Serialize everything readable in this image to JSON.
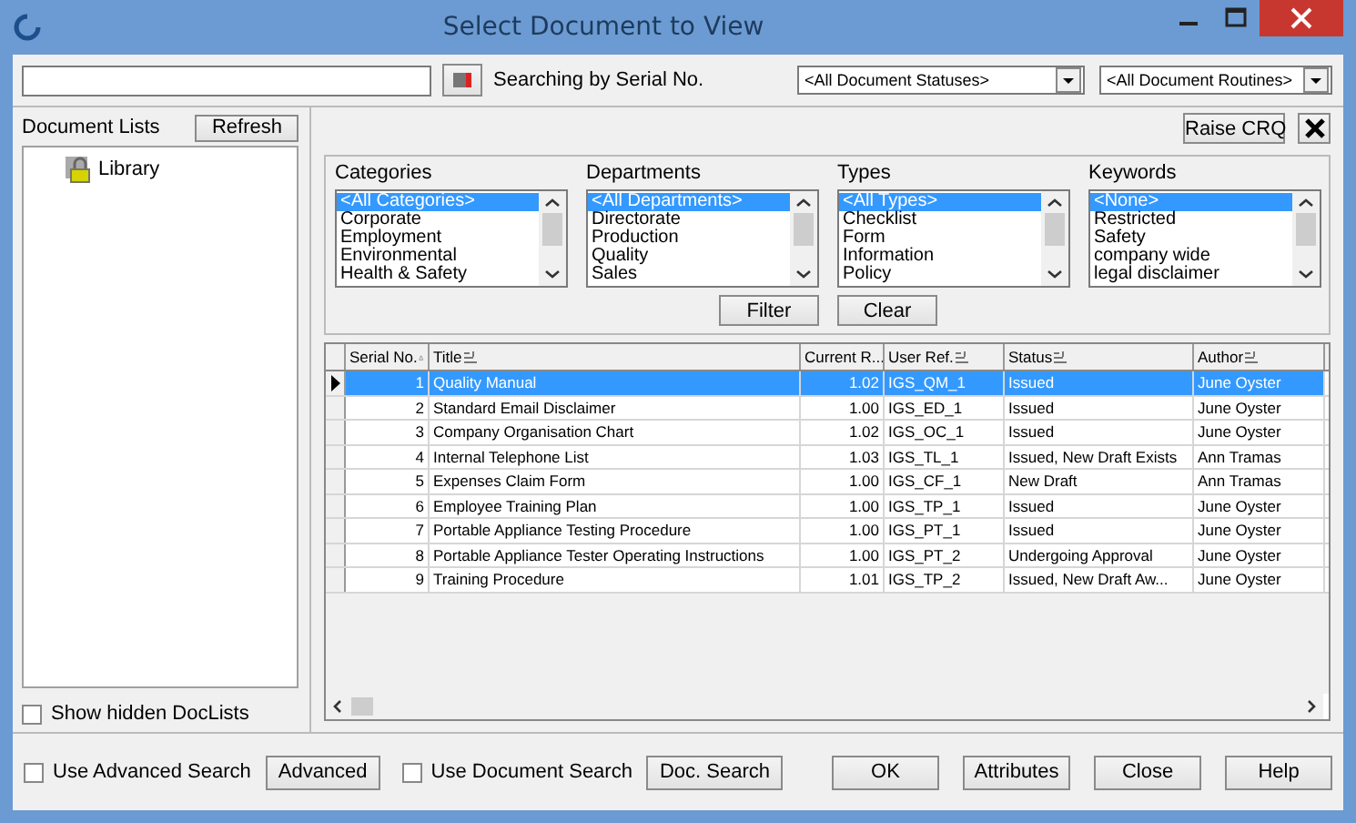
{
  "window": {
    "title": "Select Document to View"
  },
  "search": {
    "label": "Searching by Serial No.",
    "status_filter": "<All Document Statuses>",
    "routine_filter": "<All Document Routines>"
  },
  "document_lists": {
    "heading": "Document Lists",
    "refresh_button": "Refresh",
    "items": [
      {
        "label": "Library",
        "selected": false
      }
    ],
    "show_hidden": {
      "label": "Show hidden DocLists",
      "checked": false
    }
  },
  "raise_button": "Raise CRQ",
  "filters": [
    {
      "title": "Categories",
      "items": [
        {
          "label": "<All Categories>",
          "selected": true
        },
        {
          "label": "Corporate",
          "selected": false
        },
        {
          "label": "Employment",
          "selected": false
        },
        {
          "label": "Environmental",
          "selected": false
        },
        {
          "label": "Health & Safety",
          "selected": false
        }
      ]
    },
    {
      "title": "Departments",
      "items": [
        {
          "label": "<All Departments>",
          "selected": true
        },
        {
          "label": "Directorate",
          "selected": false
        },
        {
          "label": "Production",
          "selected": false
        },
        {
          "label": "Quality",
          "selected": false
        },
        {
          "label": "Sales",
          "selected": false
        }
      ]
    },
    {
      "title": "Types",
      "items": [
        {
          "label": "<All Types>",
          "selected": true
        },
        {
          "label": "Checklist",
          "selected": false
        },
        {
          "label": "Form",
          "selected": false
        },
        {
          "label": "Information",
          "selected": false
        },
        {
          "label": "Policy",
          "selected": false
        }
      ]
    },
    {
      "title": "Keywords",
      "items": [
        {
          "label": "<None>",
          "selected": true
        },
        {
          "label": "Restricted",
          "selected": false
        },
        {
          "label": "Safety",
          "selected": false
        },
        {
          "label": "company wide",
          "selected": false
        },
        {
          "label": "legal disclaimer",
          "selected": false
        }
      ]
    }
  ],
  "filter_buttons": [
    "Filter",
    "Clear"
  ],
  "table": {
    "columns": [
      {
        "label": "Serial No.",
        "kind": "sort"
      },
      {
        "label": "Title",
        "kind": "filter"
      },
      {
        "label": "Current R...",
        "kind": "plain"
      },
      {
        "label": "User Ref.",
        "kind": "filter"
      },
      {
        "label": "Status",
        "kind": "filter"
      },
      {
        "label": "Author",
        "kind": "filter"
      }
    ],
    "rows": [
      {
        "selected": true,
        "cells": [
          "1",
          "Quality Manual",
          "1.02",
          "IGS_QM_1",
          "Issued",
          "June Oyster"
        ]
      },
      {
        "selected": false,
        "cells": [
          "2",
          "Standard Email Disclaimer",
          "1.00",
          "IGS_ED_1",
          "Issued",
          "June Oyster"
        ]
      },
      {
        "selected": false,
        "cells": [
          "3",
          "Company Organisation Chart",
          "1.02",
          "IGS_OC_1",
          "Issued",
          "June Oyster"
        ]
      },
      {
        "selected": false,
        "cells": [
          "4",
          "Internal Telephone List",
          "1.03",
          "IGS_TL_1",
          "Issued, New Draft Exists",
          "Ann Tramas"
        ]
      },
      {
        "selected": false,
        "cells": [
          "5",
          "Expenses Claim Form",
          "1.00",
          "IGS_CF_1",
          "New Draft",
          "Ann Tramas"
        ]
      },
      {
        "selected": false,
        "cells": [
          "6",
          "Employee Training Plan",
          "1.00",
          "IGS_TP_1",
          "Issued",
          "June Oyster"
        ]
      },
      {
        "selected": false,
        "cells": [
          "7",
          "Portable Appliance Testing Procedure",
          "1.00",
          "IGS_PT_1",
          "Issued",
          "June Oyster"
        ]
      },
      {
        "selected": false,
        "cells": [
          "8",
          "Portable Appliance Tester Operating Instructions",
          "1.00",
          "IGS_PT_2",
          "Undergoing Approval",
          "June Oyster"
        ]
      },
      {
        "selected": false,
        "cells": [
          "9",
          "Training Procedure",
          "1.01",
          "IGS_TP_2",
          "Issued, New Draft Aw...",
          "June Oyster"
        ]
      }
    ]
  },
  "bottom": {
    "advanced_search": {
      "label": "Use Advanced Search",
      "checked": false
    },
    "advanced_button": "Advanced",
    "document_search": {
      "label": "Use Document Search",
      "checked": false
    },
    "doc_search_button": "Doc. Search",
    "buttons": [
      "OK",
      "Attributes",
      "Close",
      "Help"
    ]
  }
}
